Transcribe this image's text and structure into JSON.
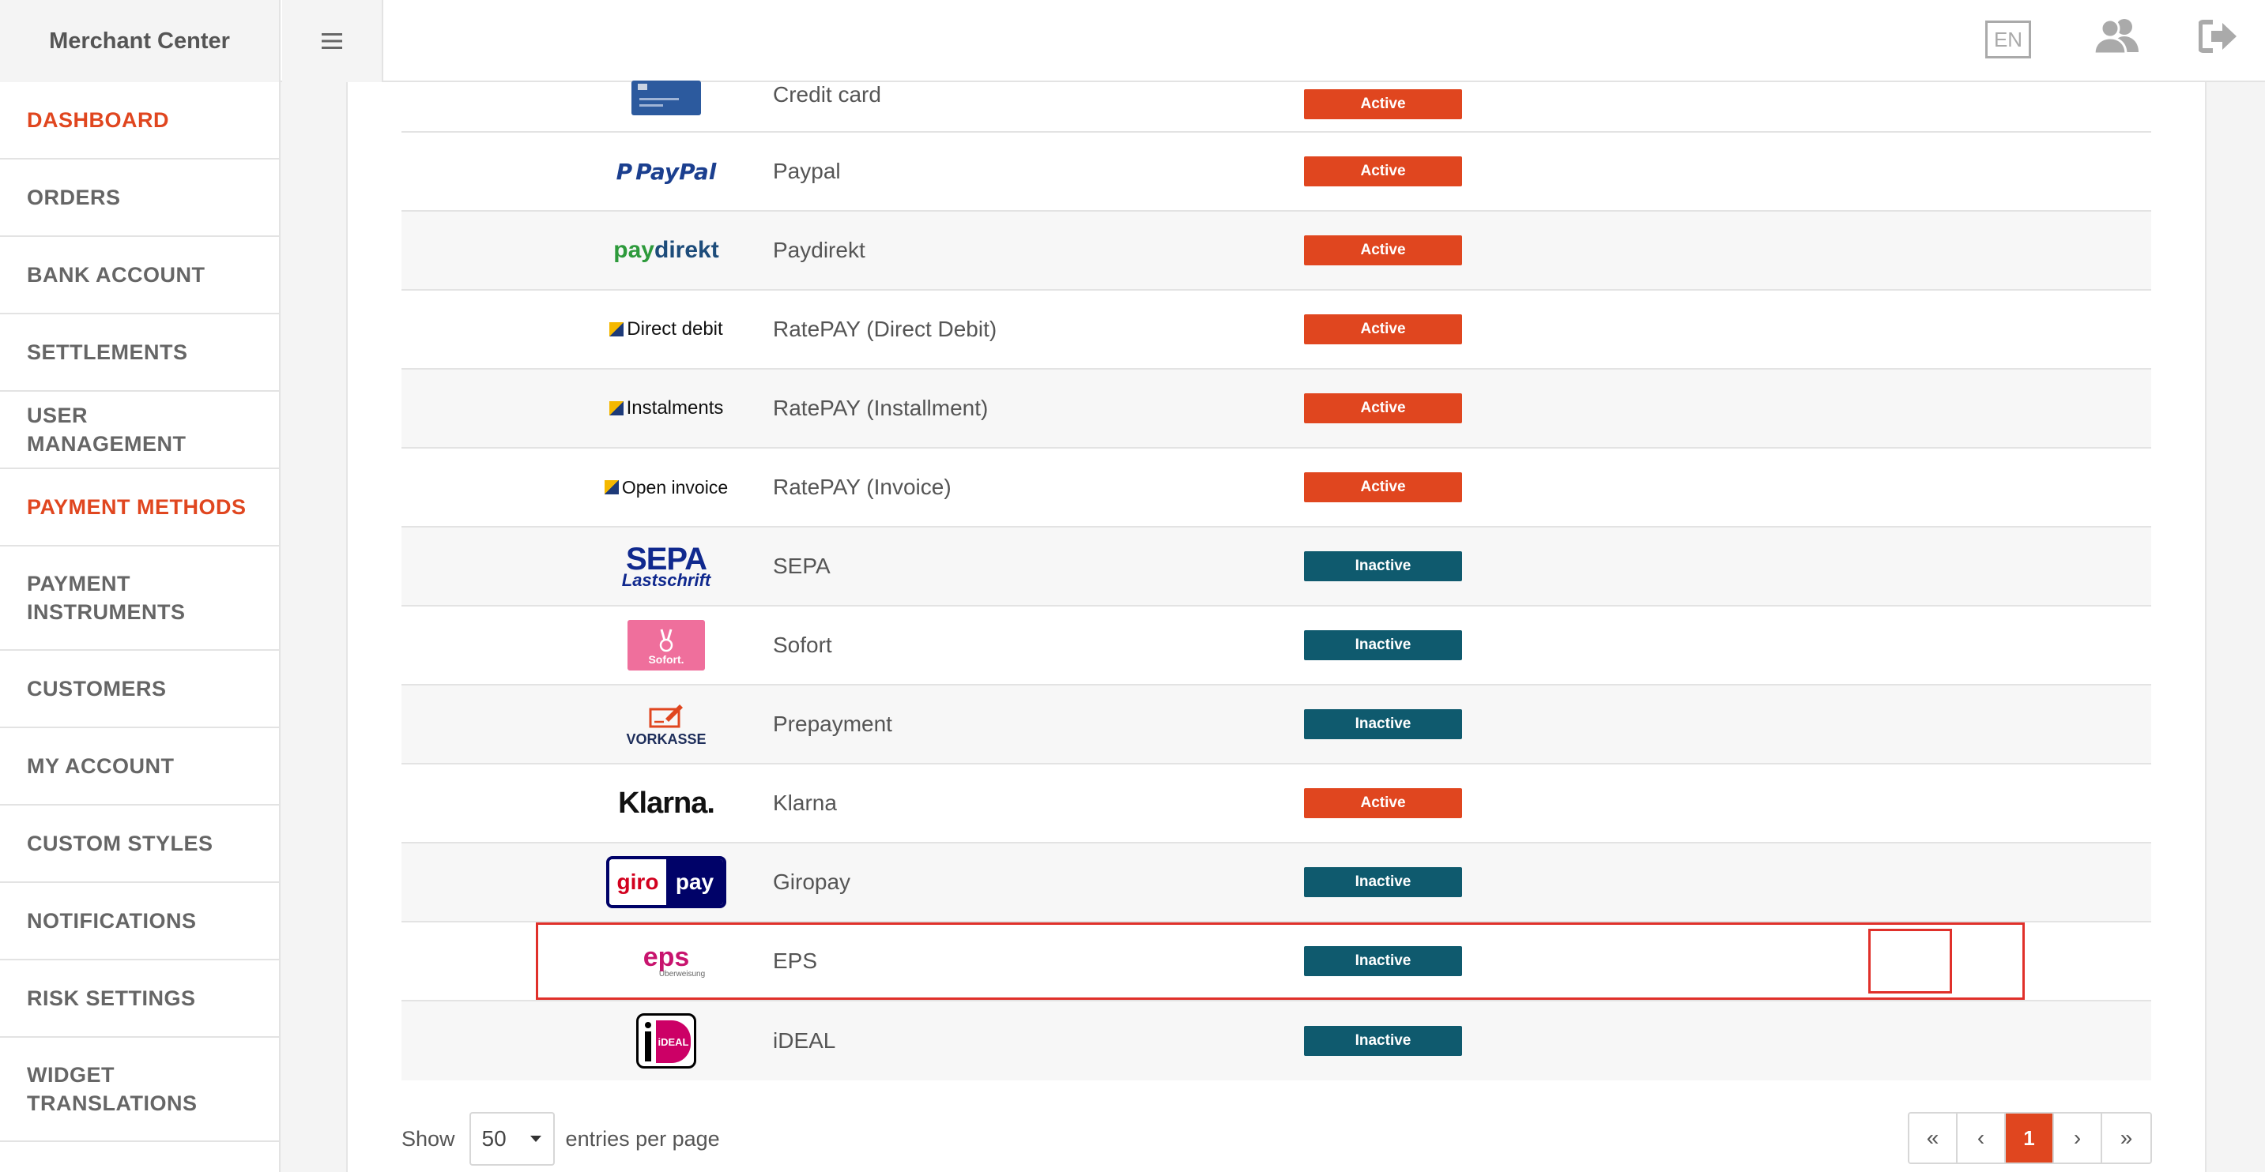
{
  "header": {
    "brand": "Merchant Center",
    "language": "EN"
  },
  "sidebar": {
    "items": [
      {
        "label": "DASHBOARD",
        "active": true
      },
      {
        "label": "ORDERS"
      },
      {
        "label": "BANK ACCOUNT"
      },
      {
        "label": "SETTLEMENTS"
      },
      {
        "label": "USER MANAGEMENT"
      },
      {
        "label": "PAYMENT METHODS",
        "active": true
      },
      {
        "label": "PAYMENT INSTRUMENTS"
      },
      {
        "label": "CUSTOMERS"
      },
      {
        "label": "MY ACCOUNT"
      },
      {
        "label": "CUSTOM STYLES"
      },
      {
        "label": "NOTIFICATIONS"
      },
      {
        "label": "RISK SETTINGS"
      },
      {
        "label": "WIDGET TRANSLATIONS"
      }
    ]
  },
  "payment_methods": [
    {
      "name": "Credit card",
      "status": "Active",
      "action": "view",
      "logo_icon": "credit-card-logo"
    },
    {
      "name": "Paypal",
      "status": "Active",
      "action": "view",
      "logo_icon": "paypal-logo",
      "logo_text": "PayPal"
    },
    {
      "name": "Paydirekt",
      "status": "Active",
      "action": "view",
      "logo_icon": "paydirekt-logo",
      "logo_text": "direkt",
      "logo_prefix": "pay"
    },
    {
      "name": "RatePAY (Direct Debit)",
      "status": "Active",
      "action": "view",
      "logo_icon": "ratepay-logo",
      "logo_text": "Direct debit"
    },
    {
      "name": "RatePAY (Installment)",
      "status": "Active",
      "action": "view",
      "logo_icon": "ratepay-logo",
      "logo_text": "Instalments"
    },
    {
      "name": "RatePAY (Invoice)",
      "status": "Active",
      "action": "view",
      "logo_icon": "ratepay-logo",
      "logo_text": "Open invoice"
    },
    {
      "name": "SEPA",
      "status": "Inactive",
      "action": "view",
      "logo_icon": "sepa-logo",
      "logo_text": "SEPA",
      "logo_subtext": "Lastschrift"
    },
    {
      "name": "Sofort",
      "status": "Inactive",
      "action": "view",
      "logo_icon": "sofort-logo",
      "logo_text": "Sofort."
    },
    {
      "name": "Prepayment",
      "status": "Inactive",
      "action": "view",
      "logo_icon": "vorkasse-logo",
      "logo_text": "VORKASSE"
    },
    {
      "name": "Klarna",
      "status": "Active",
      "action": "edit",
      "logo_icon": "klarna-logo",
      "logo_text": "Klarna."
    },
    {
      "name": "Giropay",
      "status": "Inactive",
      "action": "edit",
      "logo_icon": "giropay-logo",
      "logo_text": "giro",
      "logo_suffix": "pay"
    },
    {
      "name": "EPS",
      "status": "Inactive",
      "action": "edit",
      "logo_icon": "eps-logo",
      "logo_text": "eps",
      "logo_subtext": "Überweisung",
      "highlighted": true
    },
    {
      "name": "iDEAL",
      "status": "Inactive",
      "action": "view",
      "logo_icon": "ideal-logo",
      "logo_text": "iDEAL"
    }
  ],
  "footer": {
    "show_label": "Show",
    "entries_value": "50",
    "entries_suffix": "entries per page",
    "pagination": [
      "«",
      "‹",
      "1",
      "›",
      "»"
    ],
    "current_page": "1"
  },
  "colors": {
    "accent": "#e0461f",
    "active_badge": "#e0461f",
    "inactive_badge": "#0f5a6e",
    "highlight": "#e0302a"
  }
}
